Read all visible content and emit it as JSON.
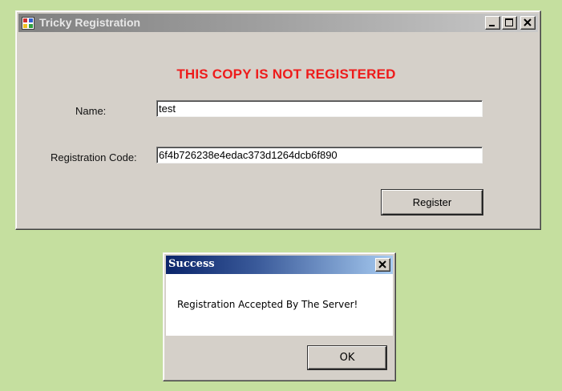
{
  "main_window": {
    "title": "Tricky Registration",
    "warning": "THIS COPY IS NOT REGISTERED",
    "name_label": "Name:",
    "name_value": "test",
    "code_label": "Registration Code:",
    "code_value": "6f4b726238e4edac373d1264dcb6f890",
    "register_label": "Register",
    "icons": [
      "app-icon",
      "minimize-icon",
      "maximize-icon",
      "close-icon"
    ]
  },
  "dialog": {
    "title": "Success",
    "message": "Registration Accepted By The Server!",
    "ok_label": "OK",
    "icons": [
      "close-icon"
    ]
  },
  "colors": {
    "desktop": "#c5df9f",
    "window_face": "#d5d0c9",
    "warning_text": "#ee1b1b",
    "inactive_title": "#9e9e9e",
    "active_title": "#0a246a"
  }
}
